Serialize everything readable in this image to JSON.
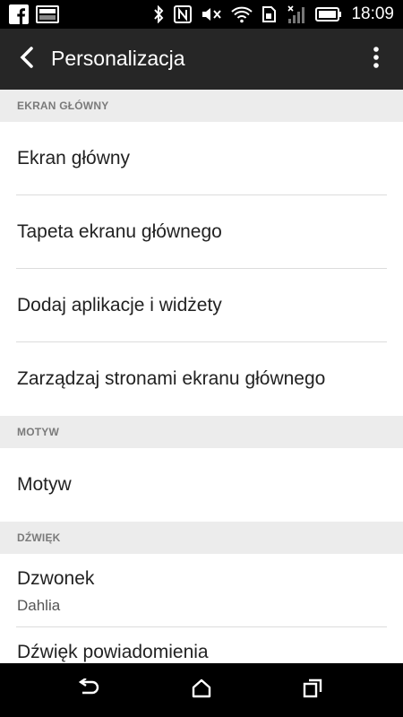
{
  "status_bar": {
    "time": "18:09",
    "left_icons": [
      "facebook-icon",
      "image-icon"
    ],
    "right_icons": [
      "bluetooth-icon",
      "nfc-icon",
      "mute-icon",
      "wifi-icon",
      "sim-icon",
      "signal-icon",
      "battery-icon"
    ]
  },
  "header": {
    "title": "Personalizacja",
    "back_icon": "chevron-left-icon",
    "menu_icon": "overflow-menu-icon"
  },
  "sections": [
    {
      "header": "EKRAN GŁÓWNY",
      "items": [
        {
          "label": "Ekran główny"
        },
        {
          "label": "Tapeta ekranu głównego"
        },
        {
          "label": "Dodaj aplikacje i widżety"
        },
        {
          "label": "Zarządzaj stronami ekranu głównego"
        }
      ]
    },
    {
      "header": "MOTYW",
      "items": [
        {
          "label": "Motyw"
        }
      ]
    },
    {
      "header": "DŹWIĘK",
      "items": [
        {
          "label": "Dzwonek",
          "sub": "Dahlia"
        },
        {
          "label": "Dźwięk powiadomienia"
        }
      ]
    }
  ],
  "nav_bar": {
    "icons": [
      "back-icon",
      "home-icon",
      "recent-apps-icon"
    ]
  }
}
